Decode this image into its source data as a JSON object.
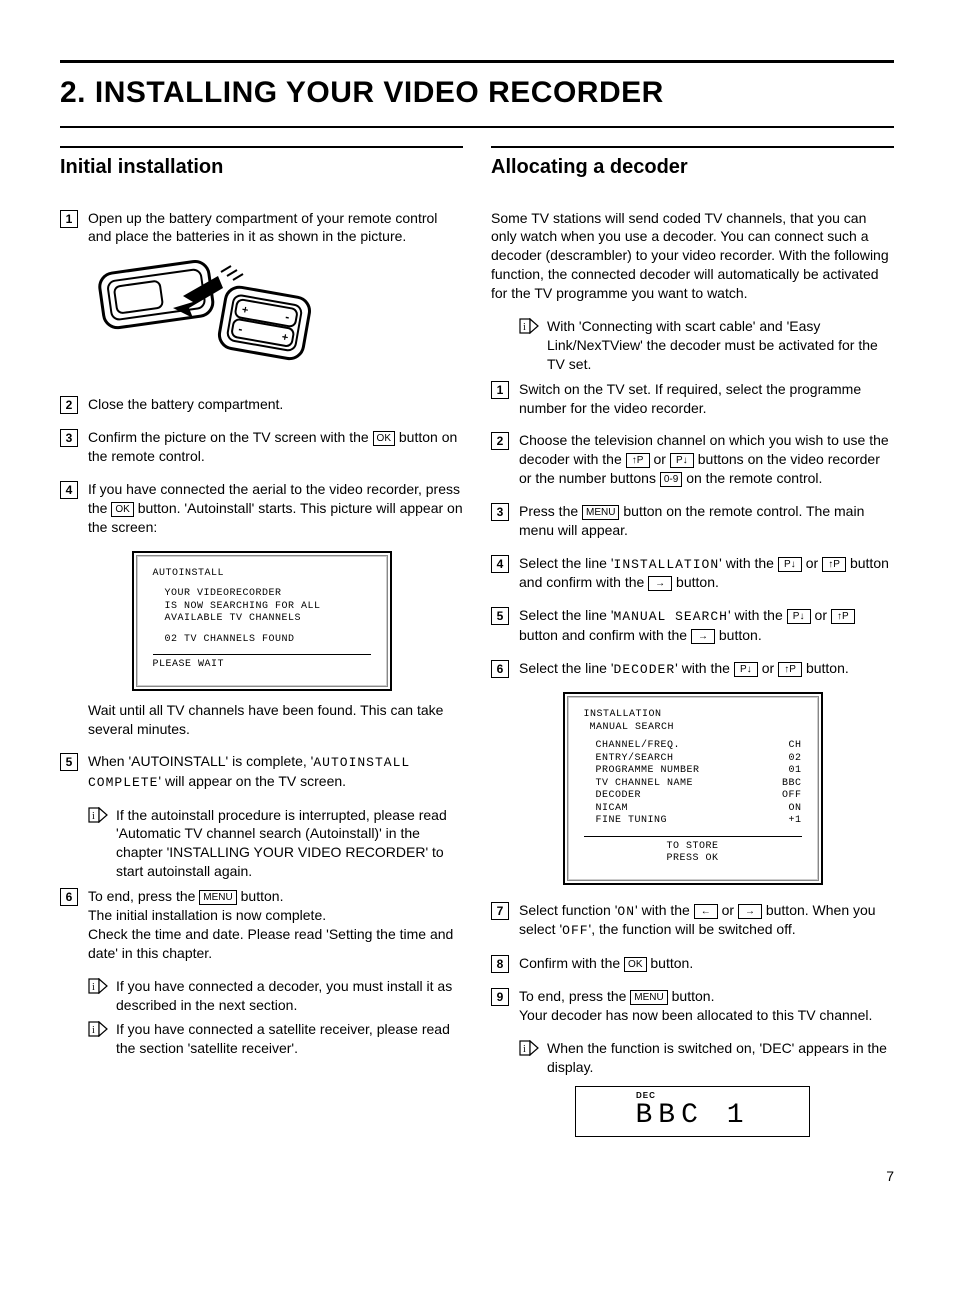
{
  "title": "2.    INSTALLING YOUR VIDEO RECORDER",
  "page_number": "7",
  "buttons": {
    "ok": "OK",
    "menu": "MENU",
    "p_up": "↑P",
    "p_down": "P↓",
    "right": "→",
    "left": "←",
    "digits": "0-9"
  },
  "left": {
    "heading": "Initial installation",
    "steps": {
      "s1": "Open up the battery compartment of your remote control and place the batteries in it as shown in the picture.",
      "s2": "Close the battery compartment.",
      "s3a": "Confirm the picture on the TV screen with the ",
      "s3b": " button on the remote control.",
      "s4a": "If you have connected the aerial to the video recorder, press the ",
      "s4b": " button. 'Autoinstall' starts. This picture will appear on the screen:",
      "s4_after": "Wait until all TV channels have been found. This can take several minutes.",
      "s5a": "When 'AUTOINSTALL' is complete, '",
      "s5_mono": "AUTOINSTALL COMPLETE",
      "s5b": "' will appear on the TV screen.",
      "s5_tip": "If the autoinstall procedure is interrupted, please read 'Automatic TV channel search (Autoinstall)' in the chapter 'INSTALLING YOUR VIDEO RECORDER' to start autoinstall again.",
      "s6a": "To end, press the ",
      "s6b": " button.",
      "s6c": "The initial installation is now complete.",
      "s6d": "Check the time and date. Please read 'Setting the time and date' in this chapter.",
      "s6_tip1": "If you have connected a decoder, you must install it as described in the next section.",
      "s6_tip2": "If you have connected a satellite receiver, please read the section 'satellite receiver'."
    },
    "screen1": {
      "l1": "AUTOINSTALL",
      "l2": "YOUR VIDEORECORDER",
      "l3": "IS NOW SEARCHING FOR ALL",
      "l4": "AVAILABLE TV CHANNELS",
      "l5": "02 TV CHANNELS FOUND",
      "l6": "PLEASE WAIT"
    }
  },
  "right": {
    "heading": "Allocating a decoder",
    "intro": "Some TV stations will send coded TV channels, that you can only watch when you use a decoder. You can connect such a decoder (descrambler) to your video recorder. With the following function, the connected decoder will automatically be activated for the TV programme you want to watch.",
    "intro_tip": "With 'Connecting with scart cable' and 'Easy Link/NexTView' the decoder must be activated for the TV set.",
    "steps": {
      "s1": "Switch on the TV set. If required, select the programme number for the video recorder.",
      "s2a": "Choose the television channel on which you wish to use the decoder with the ",
      "s2b": " or ",
      "s2c": " buttons on the video recorder or the number buttons ",
      "s2d": " on the remote control.",
      "s3a": "Press the ",
      "s3b": " button on the remote control. The main menu will appear.",
      "s4a": "Select the line '",
      "s4_mono": "INSTALLATION",
      "s4b": "' with the ",
      "s4c": " or ",
      "s4d": " button and confirm with the ",
      "s4e": " button.",
      "s5a": "Select the line '",
      "s5_mono": "MANUAL SEARCH",
      "s5b": "' with the ",
      "s5c": " or ",
      "s5d": " button and confirm with the ",
      "s5e": " button.",
      "s6a": "Select the line '",
      "s6_mono": "DECODER",
      "s6b": "' with the ",
      "s6c": " or ",
      "s6d": " button.",
      "s7a": "Select function '",
      "s7_on": "ON",
      "s7b": "' with the ",
      "s7c": " or ",
      "s7d": " button. When you select '",
      "s7_off": "OFF",
      "s7e": "', the function will be switched off.",
      "s8a": "Confirm with the ",
      "s8b": " button.",
      "s9a": "To end, press the ",
      "s9b": " button.",
      "s9c": "Your decoder has now been allocated to this TV channel.",
      "s9_tip": "When the function is switched on, 'DEC' appears in the display."
    },
    "screen2": {
      "l1": "INSTALLATION",
      "l2": "MANUAL SEARCH",
      "rows": [
        {
          "k": "CHANNEL/FREQ.",
          "v": "CH"
        },
        {
          "k": "ENTRY/SEARCH",
          "v": "02"
        },
        {
          "k": "PROGRAMME NUMBER",
          "v": "01"
        },
        {
          "k": "TV CHANNEL NAME",
          "v": "BBC"
        },
        {
          "k": "DECODER",
          "v": "OFF"
        },
        {
          "k": "NICAM",
          "v": "ON"
        },
        {
          "k": "FINE TUNING",
          "v": "+1"
        }
      ],
      "f1": "TO STORE",
      "f2": "PRESS    OK"
    },
    "display": {
      "dec": "DEC",
      "seg": "BBC 1"
    }
  }
}
